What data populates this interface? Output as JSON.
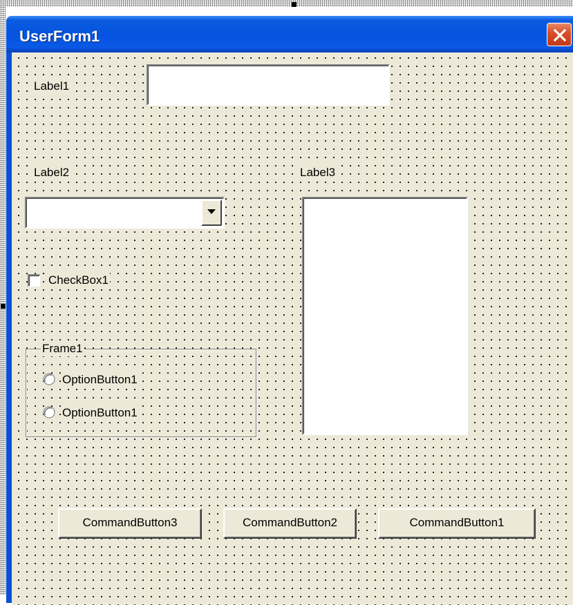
{
  "window": {
    "title": "UserForm1"
  },
  "controls": {
    "label1": "Label1",
    "textbox1_value": "",
    "label2": "Label2",
    "combobox1_value": "",
    "label3": "Label3",
    "checkbox1": {
      "label": "CheckBox1",
      "checked": false
    },
    "frame1": {
      "caption": "Frame1",
      "options": [
        {
          "label": "OptionButton1",
          "selected": false
        },
        {
          "label": "OptionButton1",
          "selected": false
        }
      ]
    },
    "buttons": [
      {
        "label": "CommandButton3"
      },
      {
        "label": "CommandButton2"
      },
      {
        "label": "CommandButton1"
      }
    ]
  },
  "icons": {
    "close": "close-icon",
    "dropdown": "chevron-down-icon",
    "radio": "radio-icon"
  },
  "colors": {
    "title_bar": "#0553e0",
    "form_background": "#ece9d8",
    "close_button": "#d84b25"
  }
}
